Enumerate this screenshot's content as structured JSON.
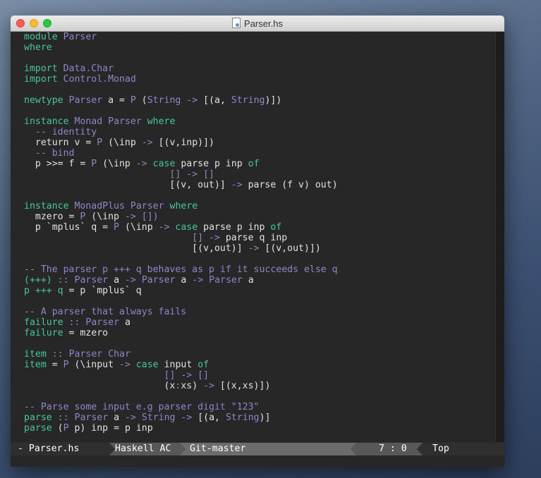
{
  "window": {
    "title": "Parser.hs"
  },
  "code_lines": [
    [
      [
        "kw",
        "module"
      ],
      [
        "st",
        " "
      ],
      [
        "ty",
        "Parser"
      ]
    ],
    [
      [
        "kw",
        "where"
      ]
    ],
    [],
    [
      [
        "kw",
        "import"
      ],
      [
        "st",
        " "
      ],
      [
        "ty",
        "Data.Char"
      ]
    ],
    [
      [
        "kw",
        "import"
      ],
      [
        "st",
        " "
      ],
      [
        "ty",
        "Control.Monad"
      ]
    ],
    [],
    [
      [
        "kw",
        "newtype"
      ],
      [
        "st",
        " "
      ],
      [
        "ty",
        "Parser"
      ],
      [
        "st",
        " a = "
      ],
      [
        "ty",
        "P"
      ],
      [
        "st",
        " ("
      ],
      [
        "ty",
        "String"
      ],
      [
        "st",
        " "
      ],
      [
        "op",
        "->"
      ],
      [
        "st",
        " [(a, "
      ],
      [
        "ty",
        "String"
      ],
      [
        "st",
        ")])"
      ]
    ],
    [],
    [
      [
        "kw",
        "instance"
      ],
      [
        "st",
        " "
      ],
      [
        "ty",
        "Monad"
      ],
      [
        "st",
        " "
      ],
      [
        "ty",
        "Parser"
      ],
      [
        "st",
        " "
      ],
      [
        "kw",
        "where"
      ]
    ],
    [
      [
        "st",
        "  "
      ],
      [
        "cm",
        "-- identity"
      ]
    ],
    [
      [
        "st",
        "  return v = "
      ],
      [
        "ty",
        "P"
      ],
      [
        "st",
        " (\\inp "
      ],
      [
        "op",
        "->"
      ],
      [
        "st",
        " [(v,inp)])"
      ]
    ],
    [
      [
        "st",
        "  "
      ],
      [
        "cm",
        "-- bind"
      ]
    ],
    [
      [
        "st",
        "  p >>= f = "
      ],
      [
        "ty",
        "P"
      ],
      [
        "st",
        " (\\inp "
      ],
      [
        "op",
        "->"
      ],
      [
        "st",
        " "
      ],
      [
        "kw",
        "case"
      ],
      [
        "st",
        " parse p inp "
      ],
      [
        "kw",
        "of"
      ]
    ],
    [
      [
        "st",
        "                          "
      ],
      [
        "ct",
        "[] -> []"
      ]
    ],
    [
      [
        "st",
        "                          [(v, out)] "
      ],
      [
        "op",
        "->"
      ],
      [
        "st",
        " parse (f v) out)"
      ]
    ],
    [],
    [
      [
        "kw",
        "instance"
      ],
      [
        "st",
        " "
      ],
      [
        "ty",
        "MonadPlus"
      ],
      [
        "st",
        " "
      ],
      [
        "ty",
        "Parser"
      ],
      [
        "st",
        " "
      ],
      [
        "kw",
        "where"
      ]
    ],
    [
      [
        "st",
        "  mzero = "
      ],
      [
        "ty",
        "P"
      ],
      [
        "st",
        " (\\inp "
      ],
      [
        "op",
        "->"
      ],
      [
        "st",
        " "
      ],
      [
        "ct",
        "[])"
      ]
    ],
    [
      [
        "st",
        "  p `mplus` q = "
      ],
      [
        "ty",
        "P"
      ],
      [
        "st",
        " (\\inp "
      ],
      [
        "op",
        "->"
      ],
      [
        "st",
        " "
      ],
      [
        "kw",
        "case"
      ],
      [
        "st",
        " parse p inp "
      ],
      [
        "kw",
        "of"
      ]
    ],
    [
      [
        "st",
        "                              "
      ],
      [
        "ct",
        "[]"
      ],
      [
        "st",
        " "
      ],
      [
        "op",
        "->"
      ],
      [
        "st",
        " parse q inp"
      ]
    ],
    [
      [
        "st",
        "                              [(v,out)] "
      ],
      [
        "op",
        "->"
      ],
      [
        "st",
        " [(v,out)])"
      ]
    ],
    [],
    [
      [
        "cm",
        "-- The parser p +++ q behaves as p if it succeeds else q"
      ]
    ],
    [
      [
        "kw",
        "(+++)"
      ],
      [
        "st",
        " "
      ],
      [
        "op",
        "::"
      ],
      [
        "st",
        " "
      ],
      [
        "ty",
        "Parser"
      ],
      [
        "st",
        " a "
      ],
      [
        "op",
        "->"
      ],
      [
        "st",
        " "
      ],
      [
        "ty",
        "Parser"
      ],
      [
        "st",
        " a "
      ],
      [
        "op",
        "->"
      ],
      [
        "st",
        " "
      ],
      [
        "ty",
        "Parser"
      ],
      [
        "st",
        " a"
      ]
    ],
    [
      [
        "kw",
        "p +++ q"
      ],
      [
        "st",
        " = p `mplus` q"
      ]
    ],
    [],
    [
      [
        "cm",
        "-- A parser that always fails"
      ]
    ],
    [
      [
        "kw",
        "failure"
      ],
      [
        "st",
        " "
      ],
      [
        "op",
        "::"
      ],
      [
        "st",
        " "
      ],
      [
        "ty",
        "Parser"
      ],
      [
        "st",
        " a"
      ]
    ],
    [
      [
        "kw",
        "failure"
      ],
      [
        "st",
        " = mzero"
      ]
    ],
    [],
    [
      [
        "kw",
        "item"
      ],
      [
        "st",
        " "
      ],
      [
        "op",
        "::"
      ],
      [
        "st",
        " "
      ],
      [
        "ty",
        "Parser"
      ],
      [
        "st",
        " "
      ],
      [
        "ty",
        "Char"
      ]
    ],
    [
      [
        "kw",
        "item"
      ],
      [
        "st",
        " = "
      ],
      [
        "ty",
        "P"
      ],
      [
        "st",
        " (\\input "
      ],
      [
        "op",
        "->"
      ],
      [
        "st",
        " "
      ],
      [
        "kw",
        "case"
      ],
      [
        "st",
        " input "
      ],
      [
        "kw",
        "of"
      ]
    ],
    [
      [
        "st",
        "                         "
      ],
      [
        "ct",
        "[] -> []"
      ]
    ],
    [
      [
        "st",
        "                         (x"
      ],
      [
        "op",
        ":"
      ],
      [
        "st",
        "xs) "
      ],
      [
        "op",
        "->"
      ],
      [
        "st",
        " [(x,xs)])"
      ]
    ],
    [],
    [
      [
        "cm",
        "-- Parse some input e.g parser digit \"123\""
      ]
    ],
    [
      [
        "kw",
        "parse"
      ],
      [
        "st",
        " "
      ],
      [
        "op",
        "::"
      ],
      [
        "st",
        " "
      ],
      [
        "ty",
        "Parser"
      ],
      [
        "st",
        " a "
      ],
      [
        "op",
        "->"
      ],
      [
        "st",
        " "
      ],
      [
        "ty",
        "String"
      ],
      [
        "st",
        " "
      ],
      [
        "op",
        "->"
      ],
      [
        "st",
        " [(a, "
      ],
      [
        "ty",
        "String"
      ],
      [
        "st",
        ")]"
      ]
    ],
    [
      [
        "kw",
        "parse"
      ],
      [
        "st",
        " ("
      ],
      [
        "ty",
        "P"
      ],
      [
        "st",
        " p) inp = p inp"
      ]
    ]
  ],
  "statusbar": {
    "file": "- Parser.hs",
    "mode": "Haskell AC",
    "git": "Git-master",
    "position": "7 :  0",
    "scroll": "Top"
  },
  "colors": {
    "keyword": "#46c79a",
    "type": "#8d86c9",
    "comment": "#8d86c9",
    "text": "#e2e2e2",
    "background": "#272727"
  }
}
